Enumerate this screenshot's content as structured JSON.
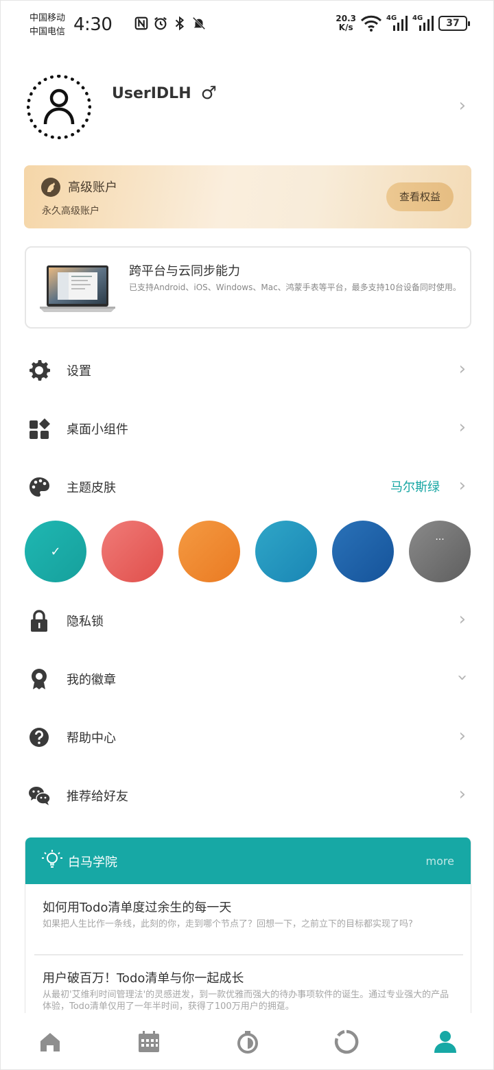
{
  "status_bar": {
    "carrier_1": "中国移动",
    "carrier_2": "中国电信",
    "time": "4:30",
    "net_speed_value": "20.3",
    "net_speed_unit": "K/s",
    "signal_1_label": "4G",
    "signal_2_label": "4G",
    "battery": "37",
    "icons": [
      "nfc-icon",
      "alarm-icon",
      "bluetooth-icon",
      "bell-muted-icon",
      "wifi-icon",
      "signal-icon",
      "battery-icon"
    ]
  },
  "profile": {
    "username": "UserIDLH",
    "gender_symbol": "♂"
  },
  "premium": {
    "title": "高级账户",
    "subtitle": "永久高级账户",
    "button": "查看权益"
  },
  "sync": {
    "title": "跨平台与云同步能力",
    "description": "已支持Android、iOS、Windows、Mac、鸿蒙手表等平台，最多支持10台设备同时使用。"
  },
  "menu": {
    "settings": "设置",
    "widgets": "桌面小组件",
    "theme": "主题皮肤",
    "theme_value": "马尔斯绿",
    "privacy_lock": "隐私锁",
    "badges": "我的徽章",
    "help": "帮助中心",
    "share": "推荐给好友"
  },
  "theme_swatches": [
    {
      "name": "teal",
      "from": "#1fb7b2",
      "to": "#16a09c",
      "selected": true
    },
    {
      "name": "red",
      "from": "#f07b78",
      "to": "#e04f4b",
      "selected": false
    },
    {
      "name": "orange",
      "from": "#f49a42",
      "to": "#ea7a22",
      "selected": false
    },
    {
      "name": "sky",
      "from": "#2fa6c7",
      "to": "#1a86b5",
      "selected": false
    },
    {
      "name": "blue",
      "from": "#2a72b8",
      "to": "#15539a",
      "selected": false
    },
    {
      "name": "gray",
      "from": "#8a8a8a",
      "to": "#5e5e5e",
      "selected": false
    }
  ],
  "academy": {
    "title": "白马学院",
    "more": "more",
    "articles": [
      {
        "title": "如何用Todo清单度过余生的每一天",
        "desc": "如果把人生比作一条线，此刻的你，走到哪个节点了？回想一下，之前立下的目标都实现了吗?"
      },
      {
        "title": "用户破百万！Todo清单与你一起成长",
        "desc": "从最初'艾维利时间管理法'的灵感迸发，到一款优雅而强大的待办事项软件的诞生。通过专业强大的产品体验，Todo清单仅用了一年半时间，获得了100万用户的拥趸。"
      }
    ]
  },
  "bottom_nav": [
    "home-icon",
    "calendar-icon",
    "timer-icon",
    "stats-icon",
    "profile-icon"
  ],
  "colors": {
    "accent": "#17a8a5",
    "premium_text": "#4a3d2e"
  }
}
